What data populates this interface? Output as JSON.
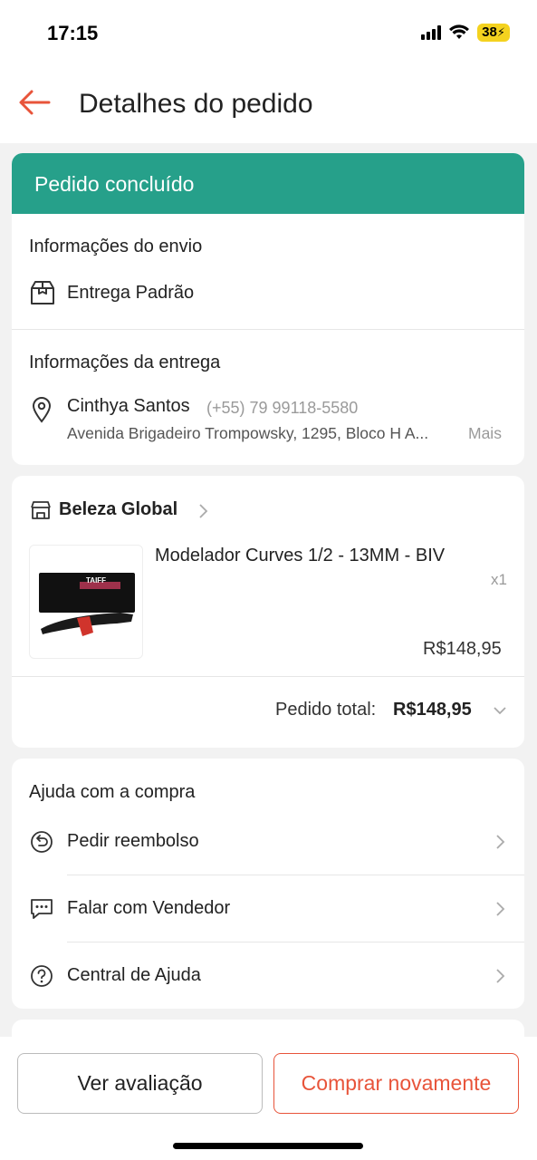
{
  "status_bar": {
    "time": "17:15",
    "battery": "38"
  },
  "header": {
    "title": "Detalhes do pedido"
  },
  "order_status": "Pedido concluído",
  "shipping": {
    "title": "Informações do envio",
    "method": "Entrega Padrão"
  },
  "delivery": {
    "title": "Informações da entrega",
    "name": "Cinthya Santos",
    "phone": "(+55) 79 99118-5580",
    "address": "Avenida Brigadeiro Trompowsky, 1295, Bloco H A...",
    "more": "Mais"
  },
  "shop": {
    "name": "Beleza Global",
    "product": {
      "title": "Modelador Curves 1/2 - 13MM - BIV",
      "qty": "x1",
      "price": "R$148,95",
      "brand": "TAIFF"
    },
    "total_label": "Pedido total:",
    "total_value": "R$148,95"
  },
  "help": {
    "title": "Ajuda com a compra",
    "items": [
      {
        "label": "Pedir reembolso",
        "icon": "refund-icon"
      },
      {
        "label": "Falar com Vendedor",
        "icon": "chat-icon"
      },
      {
        "label": "Central de Ajuda",
        "icon": "help-icon"
      }
    ]
  },
  "actions": {
    "review": "Ver avaliação",
    "buy_again": "Comprar novamente"
  },
  "colors": {
    "accent": "#e8543a",
    "status_banner": "#26a08a"
  }
}
